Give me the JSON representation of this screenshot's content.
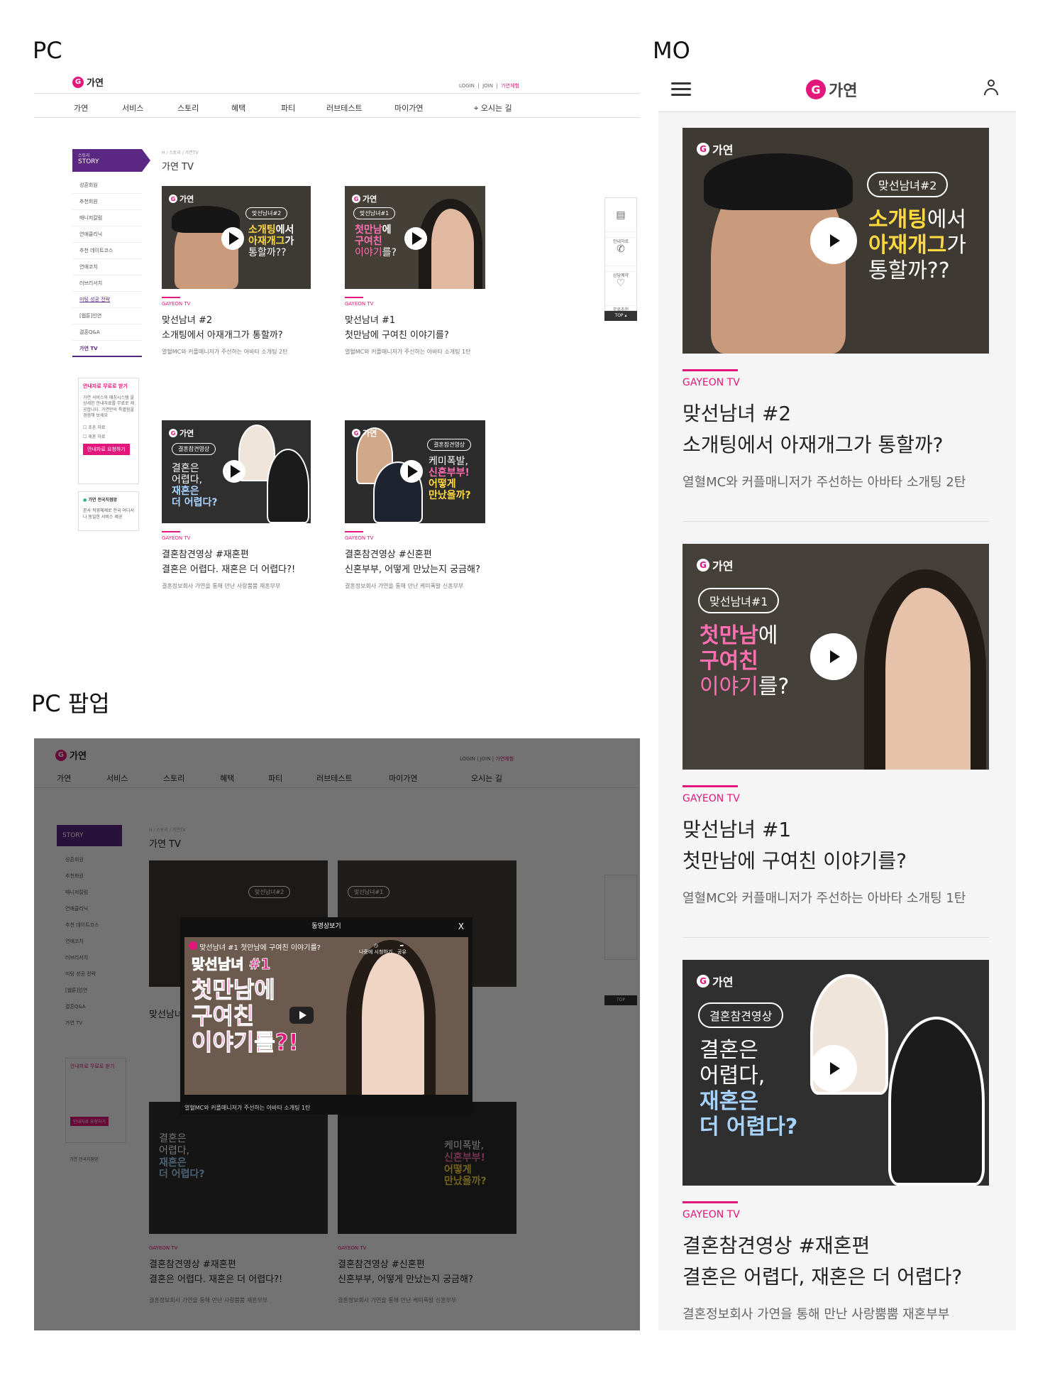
{
  "labels": {
    "pc": "PC",
    "mo": "MO",
    "pc_popup": "PC 팝업"
  },
  "brand": {
    "name": "가연",
    "accent": "#e3167b",
    "purple": "#5a2783"
  },
  "header": {
    "login": "LOGIN",
    "join": "JOIN",
    "mygayeon": "가연체험",
    "nav": [
      "가연",
      "서비스",
      "스토리",
      "혜택",
      "파티",
      "러브테스트",
      "마이가연"
    ],
    "directions": "오시는 길"
  },
  "sidebar": {
    "section_small": "스토리",
    "section": "STORY",
    "items": [
      "성혼회원",
      "추천회원",
      "매니저칼럼",
      "연애클리닉",
      "추천 데이트코스",
      "연애코치",
      "러브리서치",
      "미팅 성공 전략",
      "[웹툰]인연",
      "결혼Q&A",
      "가연 TV"
    ],
    "active_index": 10,
    "info_title": "안내자료 무료로 받기",
    "info_desc": "가연 서비스와 매칭시스템 을 상세한 안내자료를 무료로 제공합니다. 가연만의 특별함을 경험해 보세요",
    "info_opt1": "초혼 자료",
    "info_opt2": "재혼 자료",
    "info_btn": "안내자료 요청하기",
    "map_title": "가연 전국지점망",
    "map_desc": "본사 직영체제로 전국 어디서나 동일한 서비스 제공"
  },
  "page": {
    "breadcrumb": "H / 스토리 / 가연TV",
    "title": "가연 TV"
  },
  "quick": [
    "안내자료",
    "상담예약",
    "무료추천"
  ],
  "top_btn": "TOP",
  "popup": {
    "title": "동영상보기",
    "close": "X",
    "footer": "열혈MC와 커플매니저가 주선하는 아바타 소개팅 1탄",
    "video_title": "맞선남녀 #1 첫만남에 구여친 이야기를?",
    "video_big1": "첫만남에",
    "video_big2": "구여친",
    "video_big3": "이야기를?!",
    "video_tag": "맞선남녀 #1",
    "watch_later": "나중에 시청하기",
    "share": "공유"
  },
  "cards": [
    {
      "channel": "GAYEON TV",
      "tag": "맞선남녀#2",
      "cap1": "소개팅",
      "cap1b": "에서",
      "cap2": "아재개그",
      "cap2b": "가",
      "cap3": "통할까??",
      "title1": "맞선남녀 #2",
      "title2": "소개팅에서 아재개그가 통할까?",
      "desc": "열혈MC와 커플매니저가 주선하는 아바타 소개팅 2탄"
    },
    {
      "channel": "GAYEON TV",
      "tag": "맞선남녀#1",
      "cap1": "첫만남",
      "cap1b": "에",
      "cap2": "구여친",
      "cap3": "이야기",
      "cap3b": "를?",
      "title1": "맞선남녀 #1",
      "title2": "첫만남에 구여친 이야기를?",
      "desc": "열혈MC와 커플매니저가 주선하는 아바타 소개팅 1탄"
    },
    {
      "channel": "GAYEON TV",
      "tag": "결혼참견영상",
      "cap1": "결혼은",
      "cap2": "어렵다,",
      "cap3": "재혼은",
      "cap4": "더 어렵다?",
      "title1": "결혼참견영상 #재혼편",
      "title2": "결혼은 어렵다. 재혼은 더 어렵다?!",
      "title2_mo": "결혼은 어렵다, 재혼은 더 어렵다?",
      "desc": "결혼정보회사 가연을 통해 만난 사랑뿜뿜 재혼부부"
    },
    {
      "channel": "GAYEON TV",
      "tag": "결혼참견영상",
      "cap1": "케미폭발,",
      "cap2": "신혼부부!",
      "cap3": "어떻게",
      "cap4": "만났을까?",
      "title1": "결혼참견영상 #신혼편",
      "title2": "신혼부부, 어떻게 만났는지 궁금해?",
      "desc": "결혼정보회사 가연을 통해 만난 케미폭발 신혼부부"
    }
  ]
}
